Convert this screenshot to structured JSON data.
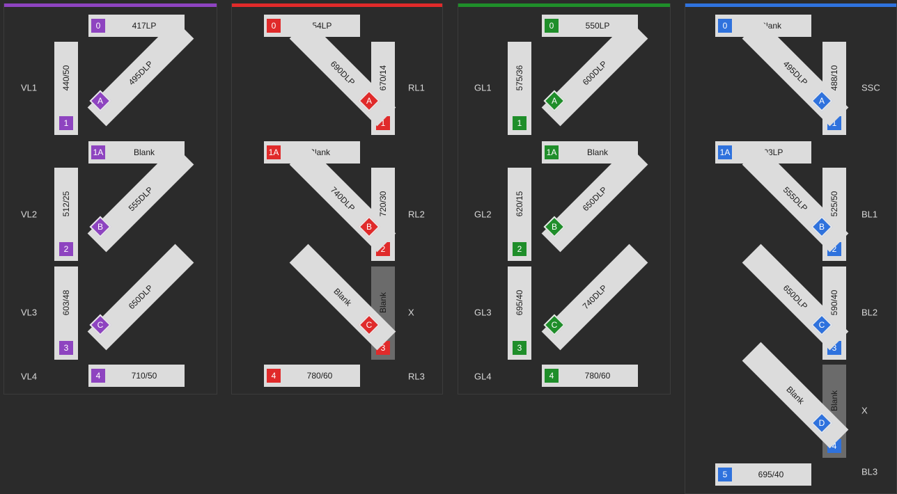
{
  "panels": [
    {
      "color": "#8e44c0",
      "horizontal": [
        {
          "badge": "0",
          "label": "417LP"
        },
        {
          "badge": "1A",
          "label": "Blank"
        },
        {
          "badge": "4",
          "label": "710/50"
        }
      ],
      "vertical": [
        {
          "badge": "1",
          "label": "440/50",
          "blank": false
        },
        {
          "badge": "2",
          "label": "512/25",
          "blank": false
        },
        {
          "badge": "3",
          "label": "603/48",
          "blank": false
        }
      ],
      "dichroics": [
        {
          "badge": "A",
          "label": "495DLP",
          "dir": "up"
        },
        {
          "badge": "B",
          "label": "555DLP",
          "dir": "up"
        },
        {
          "badge": "C",
          "label": "650DLP",
          "dir": "up"
        }
      ],
      "side_labels": [
        "VL1",
        "VL2",
        "VL3",
        "VL4"
      ]
    },
    {
      "color": "#e02a2a",
      "horizontal": [
        {
          "badge": "0",
          "label": "654LP"
        },
        {
          "badge": "1A",
          "label": "Blank"
        },
        {
          "badge": "4",
          "label": "780/60"
        }
      ],
      "vertical": [
        {
          "badge": "1",
          "label": "670/14",
          "blank": false
        },
        {
          "badge": "2",
          "label": "720/30",
          "blank": false
        },
        {
          "badge": "3",
          "label": "Blank",
          "blank": true
        }
      ],
      "dichroics": [
        {
          "badge": "A",
          "label": "690DLP",
          "dir": "down"
        },
        {
          "badge": "B",
          "label": "740DLP",
          "dir": "down"
        },
        {
          "badge": "C",
          "label": "Blank",
          "dir": "down"
        }
      ],
      "side_labels": [
        "RL1",
        "RL2",
        "X",
        "RL3"
      ]
    },
    {
      "color": "#1f8e2a",
      "horizontal": [
        {
          "badge": "0",
          "label": "550LP"
        },
        {
          "badge": "1A",
          "label": "Blank"
        },
        {
          "badge": "4",
          "label": "780/60"
        }
      ],
      "vertical": [
        {
          "badge": "1",
          "label": "575/36",
          "blank": false
        },
        {
          "badge": "2",
          "label": "620/15",
          "blank": false
        },
        {
          "badge": "3",
          "label": "695/40",
          "blank": false
        }
      ],
      "dichroics": [
        {
          "badge": "A",
          "label": "600DLP",
          "dir": "up"
        },
        {
          "badge": "B",
          "label": "650DLP",
          "dir": "up"
        },
        {
          "badge": "C",
          "label": "740DLP",
          "dir": "up"
        }
      ],
      "side_labels": [
        "GL1",
        "GL2",
        "GL3",
        "GL4"
      ]
    },
    {
      "color": "#2f72dd",
      "horizontal": [
        {
          "badge": "0",
          "label": "Blank"
        },
        {
          "badge": "1A",
          "label": "503LP"
        },
        {
          "badge": "5",
          "label": "695/40"
        }
      ],
      "vertical": [
        {
          "badge": "1",
          "label": "488/10",
          "blank": false
        },
        {
          "badge": "2",
          "label": "525/50",
          "blank": false
        },
        {
          "badge": "3",
          "label": "590/40",
          "blank": false
        },
        {
          "badge": "4",
          "label": "Blank",
          "blank": true
        }
      ],
      "dichroics": [
        {
          "badge": "A",
          "label": "495DLP",
          "dir": "down"
        },
        {
          "badge": "B",
          "label": "555DLP",
          "dir": "down"
        },
        {
          "badge": "C",
          "label": "650DLP",
          "dir": "down"
        },
        {
          "badge": "D",
          "label": "Blank",
          "dir": "down"
        }
      ],
      "side_labels": [
        "SSC",
        "BL1",
        "BL2",
        "X",
        "BL3"
      ]
    }
  ]
}
